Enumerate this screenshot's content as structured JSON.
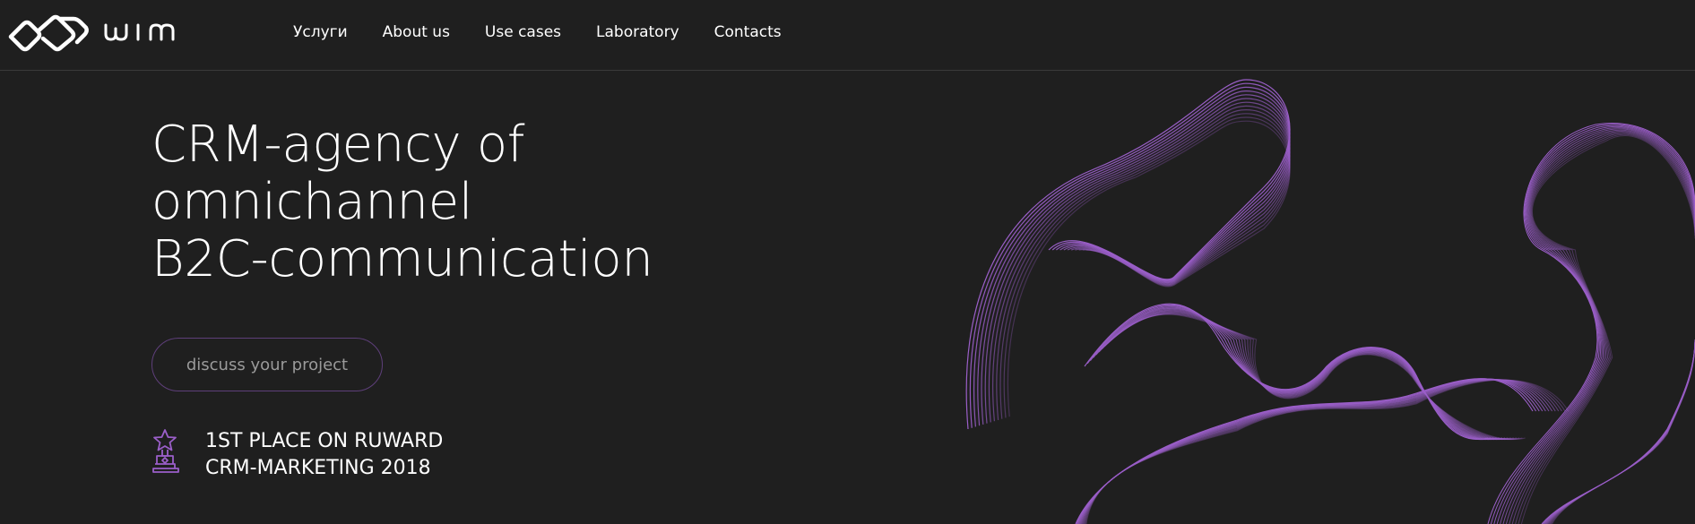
{
  "brand": {
    "name": "wim",
    "accent_color": "#9b5fc9",
    "background_color": "#1f1f1f"
  },
  "nav": {
    "items": [
      {
        "label": "Услуги"
      },
      {
        "label": "About us"
      },
      {
        "label": "Use cases"
      },
      {
        "label": "Laboratory"
      },
      {
        "label": "Contacts"
      }
    ]
  },
  "hero": {
    "title_lines": [
      "CRM-agency of",
      "omnichannel",
      "B2C-communication"
    ],
    "cta_label": "discuss your project"
  },
  "award": {
    "icon": "trophy-star-icon",
    "lines": [
      "1ST PLACE ON RUWARD",
      "CRM-MARKETING 2018"
    ]
  },
  "decoration": {
    "icon": "wave-lines-illustration"
  }
}
